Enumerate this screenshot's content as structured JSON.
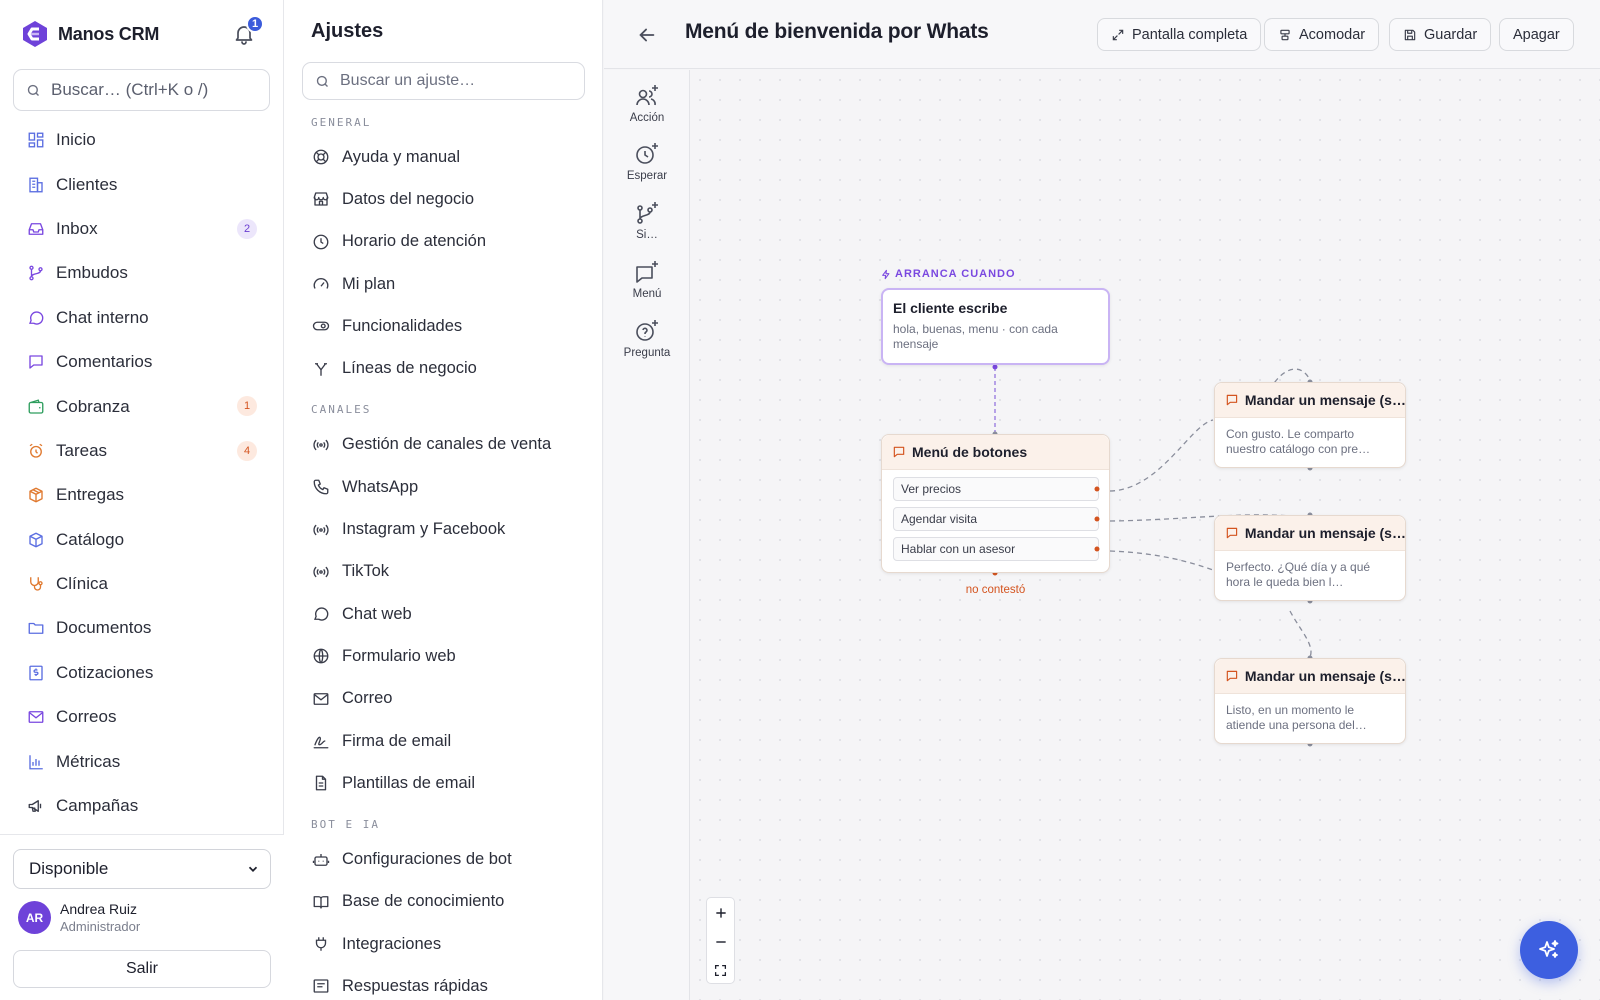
{
  "app": {
    "name": "Manos CRM",
    "notifications": "1"
  },
  "search": {
    "placeholder": "Buscar… (Ctrl+K o /)"
  },
  "nav": [
    {
      "label": "Inicio",
      "icon": "grid-icon"
    },
    {
      "label": "Clientes",
      "icon": "building-icon"
    },
    {
      "label": "Inbox",
      "icon": "inbox-icon",
      "badge": "2"
    },
    {
      "label": "Embudos",
      "icon": "branch-icon"
    },
    {
      "label": "Chat interno",
      "icon": "chat-bubble-icon"
    },
    {
      "label": "Comentarios",
      "icon": "comment-icon"
    },
    {
      "label": "Cobranza",
      "icon": "wallet-icon",
      "badge": "1"
    },
    {
      "label": "Tareas",
      "icon": "alarm-clock-icon",
      "badge": "4"
    },
    {
      "label": "Entregas",
      "icon": "package-icon"
    },
    {
      "label": "Catálogo",
      "icon": "box-icon"
    },
    {
      "label": "Clínica",
      "icon": "stethoscope-icon"
    },
    {
      "label": "Documentos",
      "icon": "folder-icon"
    },
    {
      "label": "Cotizaciones",
      "icon": "dollar-doc-icon"
    },
    {
      "label": "Correos",
      "icon": "mail-icon"
    },
    {
      "label": "Métricas",
      "icon": "bar-chart-icon"
    },
    {
      "label": "Campañas",
      "icon": "megaphone-icon"
    }
  ],
  "status": {
    "value": "Disponible"
  },
  "user": {
    "initials": "AR",
    "name": "Andrea Ruiz",
    "role": "Administrador"
  },
  "logout_label": "Salir",
  "settings": {
    "title": "Ajustes",
    "search_placeholder": "Buscar un ajuste…",
    "general_label": "GENERAL",
    "general": [
      {
        "label": "Ayuda y manual",
        "icon": "lifebuoy-icon"
      },
      {
        "label": "Datos del negocio",
        "icon": "store-icon"
      },
      {
        "label": "Horario de atención",
        "icon": "clock-icon"
      },
      {
        "label": "Mi plan",
        "icon": "gauge-icon"
      },
      {
        "label": "Funcionalidades",
        "icon": "toggle-icon"
      },
      {
        "label": "Líneas de negocio",
        "icon": "split-icon"
      }
    ],
    "channels_label": "CANALES",
    "channels": [
      {
        "label": "Gestión de canales de venta",
        "icon": "broadcast-icon"
      },
      {
        "label": "WhatsApp",
        "icon": "phone-icon"
      },
      {
        "label": "Instagram y Facebook",
        "icon": "broadcast-icon"
      },
      {
        "label": "TikTok",
        "icon": "broadcast-icon"
      },
      {
        "label": "Chat web",
        "icon": "chat-bubble-icon"
      },
      {
        "label": "Formulario web",
        "icon": "globe-icon"
      },
      {
        "label": "Correo",
        "icon": "mail-icon"
      },
      {
        "label": "Firma de email",
        "icon": "signature-icon"
      },
      {
        "label": "Plantillas de email",
        "icon": "document-icon"
      }
    ],
    "bot_label": "BOT E IA",
    "bot": [
      {
        "label": "Configuraciones de bot",
        "icon": "bot-icon"
      },
      {
        "label": "Base de conocimiento",
        "icon": "book-icon"
      },
      {
        "label": "Integraciones",
        "icon": "plug-icon"
      },
      {
        "label": "Respuestas rápidas",
        "icon": "message-lines-icon"
      }
    ]
  },
  "editor": {
    "title": "Menú de bienvenida por WhatsApp",
    "buttons": {
      "fullscreen": "Pantalla completa",
      "arrange": "Acomodar",
      "save": "Guardar",
      "off": "Apagar"
    },
    "palette": [
      "Acción",
      "Esperar",
      "Si…",
      "Menú",
      "Pregunta"
    ],
    "trigger_tag": "ARRANCA CUANDO",
    "trigger": {
      "title": "El cliente escribe",
      "subtitle": "hola, buenas, menu · con cada mensaje"
    },
    "menu_node": {
      "title": "Menú de botones",
      "options": [
        "Ver precios",
        "Agendar visita",
        "Hablar con un asesor"
      ],
      "no_answer": "no contestó"
    },
    "messages": [
      {
        "title": "Mandar un mensaje (s…",
        "body": "Con gusto. Le comparto nuestro catálogo con pre…"
      },
      {
        "title": "Mandar un mensaje (s…",
        "body": "Perfecto. ¿Qué día y a qué hora le queda bien l…"
      },
      {
        "title": "Mandar un mensaje (s…",
        "body": "Listo, en un momento le atiende una persona del…"
      }
    ],
    "zoom": [
      "+",
      "–",
      "⛶"
    ]
  },
  "colors": {
    "accent": "#3d5fe0",
    "brand": "#6e42d9",
    "trigger_border": "#c9b4f4",
    "node_accent": "#d4541f"
  }
}
